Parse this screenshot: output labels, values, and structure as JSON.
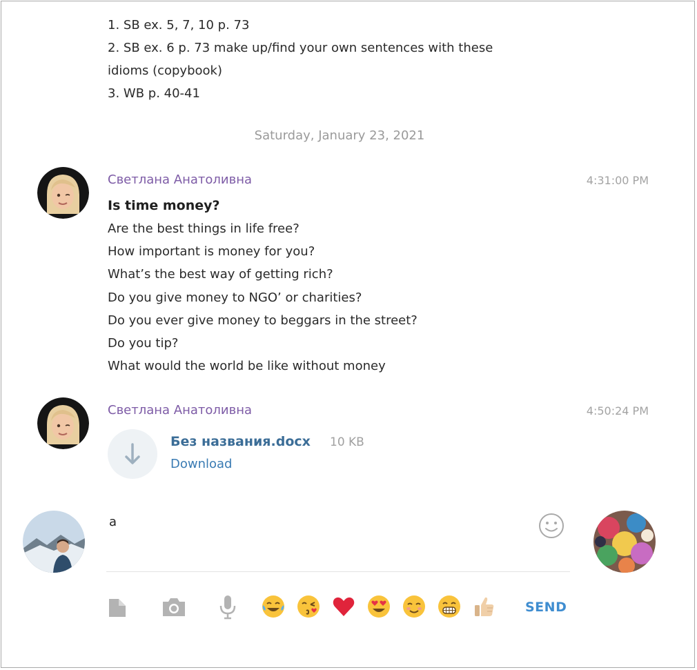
{
  "homework": {
    "lines": [
      "1. SB ex. 5, 7, 10 p. 73",
      "2. SB ex. 6 p. 73 make up/find your own sentences with these",
      "idioms (copybook)",
      "3. WB p. 40-41"
    ]
  },
  "date_separator": "Saturday, January 23, 2021",
  "messages": [
    {
      "sender": "Светлана Анатоливна",
      "time": "4:31:00 PM",
      "title": "Is time money?",
      "lines": [
        "Are the best things in life free?",
        "How important is money for you?",
        "What’s the best way of getting rich?",
        "Do you give money to NGO’ or charities?",
        "Do you ever give money to beggars in the street?",
        "Do you tip?",
        "What would the world be like without money"
      ]
    },
    {
      "sender": "Светлана Анатоливна",
      "time": "4:50:24 PM",
      "file": {
        "name": "Без названия.docx",
        "size": "10 KB",
        "action": "Download"
      }
    }
  ],
  "composer": {
    "input_value": "a",
    "send_label": "SEND",
    "tools": [
      "file-icon",
      "camera-icon",
      "microphone-icon"
    ],
    "quick_emojis": [
      "tears-of-joy",
      "kissing-heart",
      "red-heart",
      "heart-eyes",
      "smiling-face",
      "grinning-teeth",
      "thumbs-up"
    ]
  },
  "colors": {
    "sender": "#7d5ba6",
    "link": "#3a7bb3",
    "send": "#3f8dd0",
    "muted": "#a3a3a3"
  }
}
